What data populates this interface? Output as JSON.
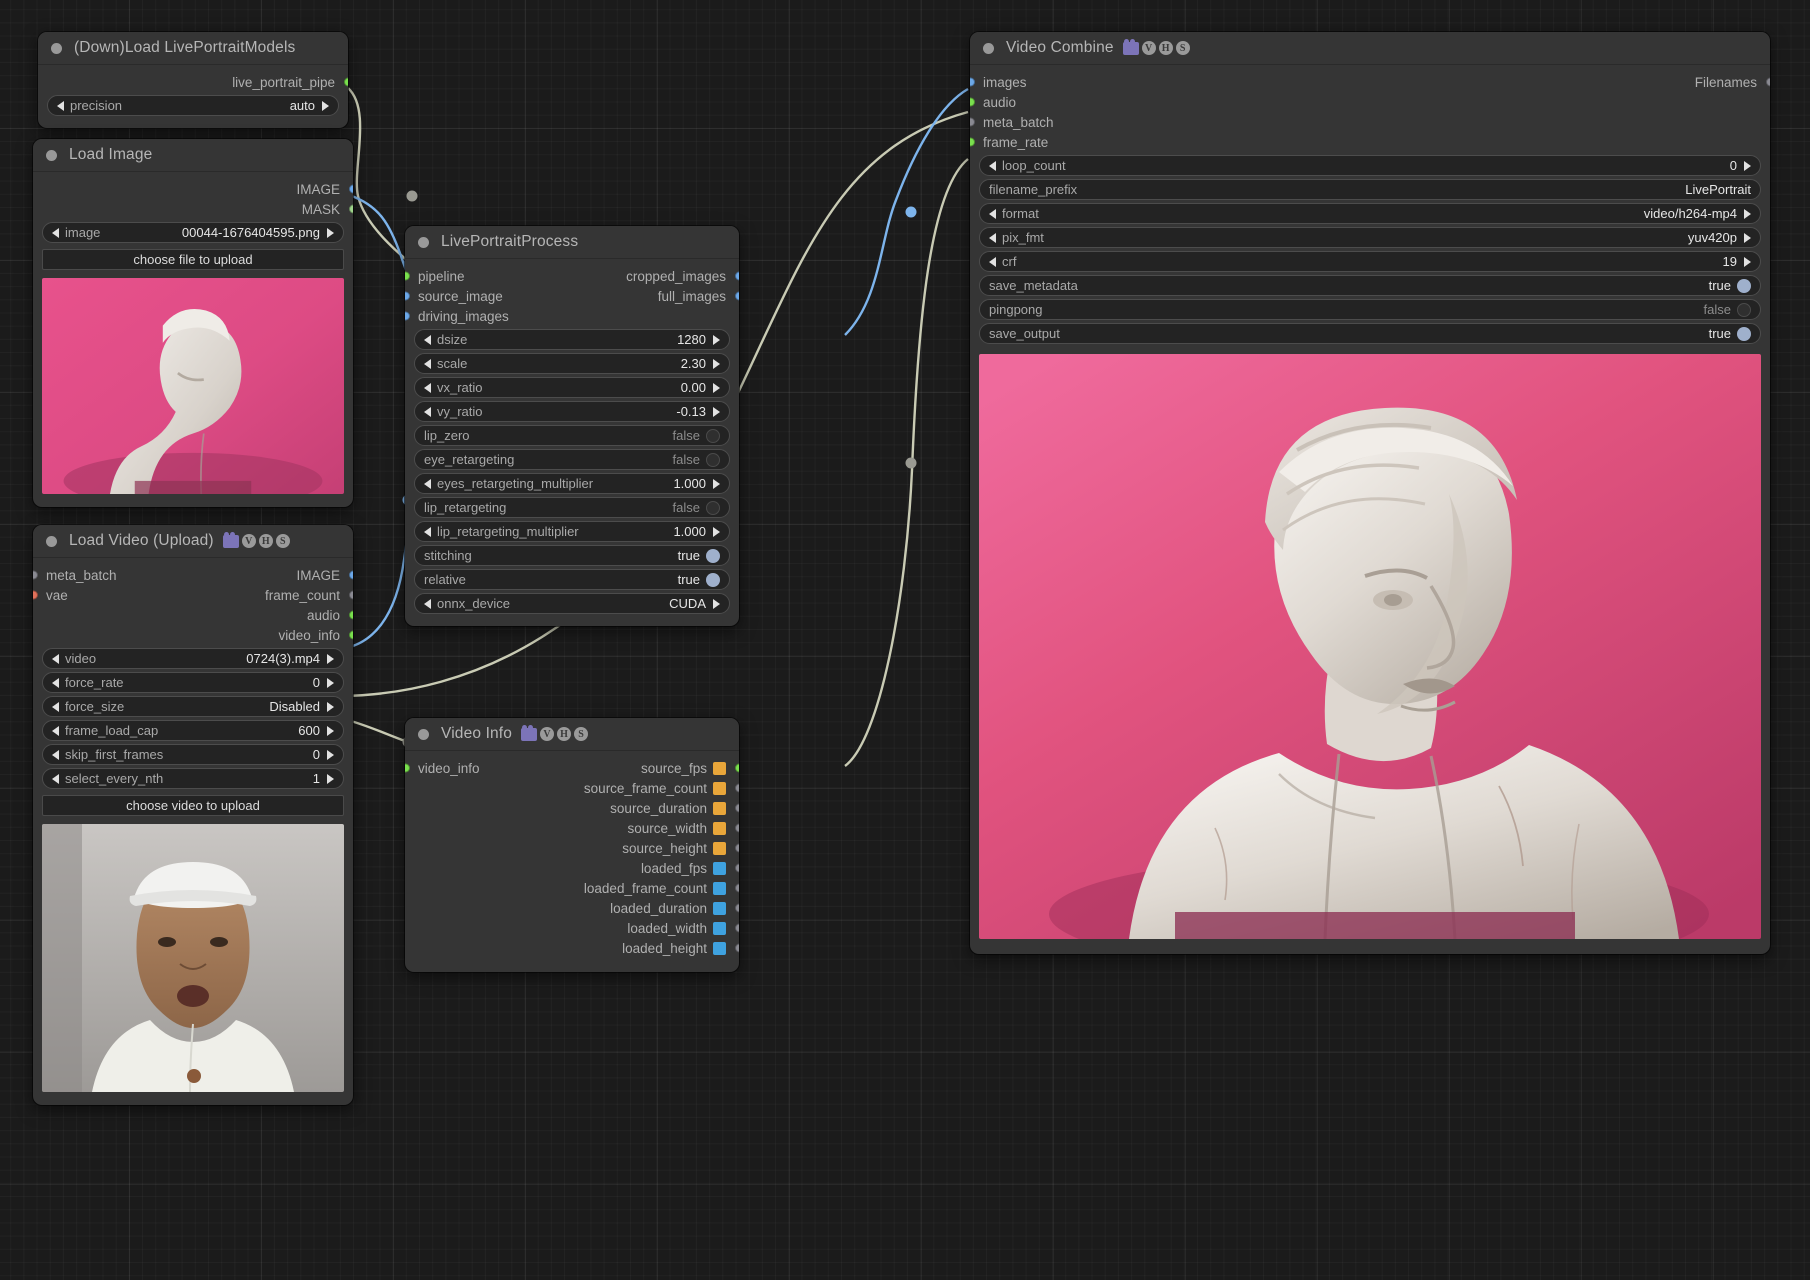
{
  "canvas": {
    "background": "#1b1b1b",
    "grid": true
  },
  "nodes": {
    "load_models": {
      "title": "(Down)Load LivePortraitModels",
      "outputs": [
        {
          "label": "live_portrait_pipe",
          "color": "green"
        }
      ],
      "widgets": [
        {
          "name": "precision",
          "value": "auto",
          "type": "combo"
        }
      ]
    },
    "load_image": {
      "title": "Load Image",
      "outputs": [
        {
          "label": "IMAGE",
          "color": "blue"
        },
        {
          "label": "MASK",
          "color": "mgreen"
        }
      ],
      "widgets": [
        {
          "name": "image",
          "value": "00044-1676404595.png",
          "type": "combo"
        }
      ],
      "button": "choose file to upload"
    },
    "load_video": {
      "title": "Load Video (Upload)",
      "badges": [
        "camera-icon",
        "V",
        "H",
        "S"
      ],
      "inputs": [
        {
          "label": "meta_batch",
          "color": "gray"
        },
        {
          "label": "vae",
          "color": "red"
        }
      ],
      "outputs": [
        {
          "label": "IMAGE",
          "color": "blue"
        },
        {
          "label": "frame_count",
          "color": "gray"
        },
        {
          "label": "audio",
          "color": "green"
        },
        {
          "label": "video_info",
          "color": "green"
        }
      ],
      "widgets": [
        {
          "name": "video",
          "value": "0724(3).mp4",
          "type": "combo"
        },
        {
          "name": "force_rate",
          "value": "0",
          "type": "number"
        },
        {
          "name": "force_size",
          "value": "Disabled",
          "type": "combo"
        },
        {
          "name": "frame_load_cap",
          "value": "600",
          "type": "number"
        },
        {
          "name": "skip_first_frames",
          "value": "0",
          "type": "number"
        },
        {
          "name": "select_every_nth",
          "value": "1",
          "type": "number"
        }
      ],
      "button": "choose video to upload"
    },
    "live_portrait_process": {
      "title": "LivePortraitProcess",
      "inputs": [
        {
          "label": "pipeline",
          "color": "green"
        },
        {
          "label": "source_image",
          "color": "blue"
        },
        {
          "label": "driving_images",
          "color": "blue"
        }
      ],
      "outputs": [
        {
          "label": "cropped_images",
          "color": "blue"
        },
        {
          "label": "full_images",
          "color": "blue"
        }
      ],
      "widgets": [
        {
          "name": "dsize",
          "value": "1280",
          "type": "number"
        },
        {
          "name": "scale",
          "value": "2.30",
          "type": "number"
        },
        {
          "name": "vx_ratio",
          "value": "0.00",
          "type": "number"
        },
        {
          "name": "vy_ratio",
          "value": "-0.13",
          "type": "number"
        },
        {
          "name": "lip_zero",
          "value": "false",
          "type": "toggle"
        },
        {
          "name": "eye_retargeting",
          "value": "false",
          "type": "toggle"
        },
        {
          "name": "eyes_retargeting_multiplier",
          "value": "1.000",
          "type": "number"
        },
        {
          "name": "lip_retargeting",
          "value": "false",
          "type": "toggle"
        },
        {
          "name": "lip_retargeting_multiplier",
          "value": "1.000",
          "type": "number"
        },
        {
          "name": "stitching",
          "value": "true",
          "type": "toggle"
        },
        {
          "name": "relative",
          "value": "true",
          "type": "toggle"
        },
        {
          "name": "onnx_device",
          "value": "CUDA",
          "type": "combo"
        }
      ]
    },
    "video_info": {
      "title": "Video Info",
      "badges": [
        "camera-icon",
        "V",
        "H",
        "S"
      ],
      "inputs": [
        {
          "label": "video_info",
          "color": "green"
        }
      ],
      "outputs": [
        {
          "label": "source_fps",
          "swatch": "orange",
          "color": "green"
        },
        {
          "label": "source_frame_count",
          "swatch": "orange",
          "color": "gray"
        },
        {
          "label": "source_duration",
          "swatch": "orange",
          "color": "gray"
        },
        {
          "label": "source_width",
          "swatch": "orange",
          "color": "gray"
        },
        {
          "label": "source_height",
          "swatch": "orange",
          "color": "gray"
        },
        {
          "label": "loaded_fps",
          "swatch": "blue",
          "color": "gray"
        },
        {
          "label": "loaded_frame_count",
          "swatch": "blue",
          "color": "gray"
        },
        {
          "label": "loaded_duration",
          "swatch": "blue",
          "color": "gray"
        },
        {
          "label": "loaded_width",
          "swatch": "blue",
          "color": "gray"
        },
        {
          "label": "loaded_height",
          "swatch": "blue",
          "color": "gray"
        }
      ]
    },
    "video_combine": {
      "title": "Video Combine",
      "badges": [
        "camera-icon",
        "V",
        "H",
        "S"
      ],
      "inputs": [
        {
          "label": "images",
          "color": "blue"
        },
        {
          "label": "audio",
          "color": "green"
        },
        {
          "label": "meta_batch",
          "color": "gray"
        },
        {
          "label": "frame_rate",
          "color": "green"
        }
      ],
      "outputs": [
        {
          "label": "Filenames",
          "color": "gray"
        }
      ],
      "widgets": [
        {
          "name": "loop_count",
          "value": "0",
          "type": "number"
        },
        {
          "name": "filename_prefix",
          "value": "LivePortrait",
          "type": "text"
        },
        {
          "name": "format",
          "value": "video/h264-mp4",
          "type": "combo"
        },
        {
          "name": "pix_fmt",
          "value": "yuv420p",
          "type": "combo"
        },
        {
          "name": "crf",
          "value": "19",
          "type": "number"
        },
        {
          "name": "save_metadata",
          "value": "true",
          "type": "toggle"
        },
        {
          "name": "pingpong",
          "value": "false",
          "type": "toggle"
        },
        {
          "name": "save_output",
          "value": "true",
          "type": "toggle"
        }
      ]
    }
  }
}
